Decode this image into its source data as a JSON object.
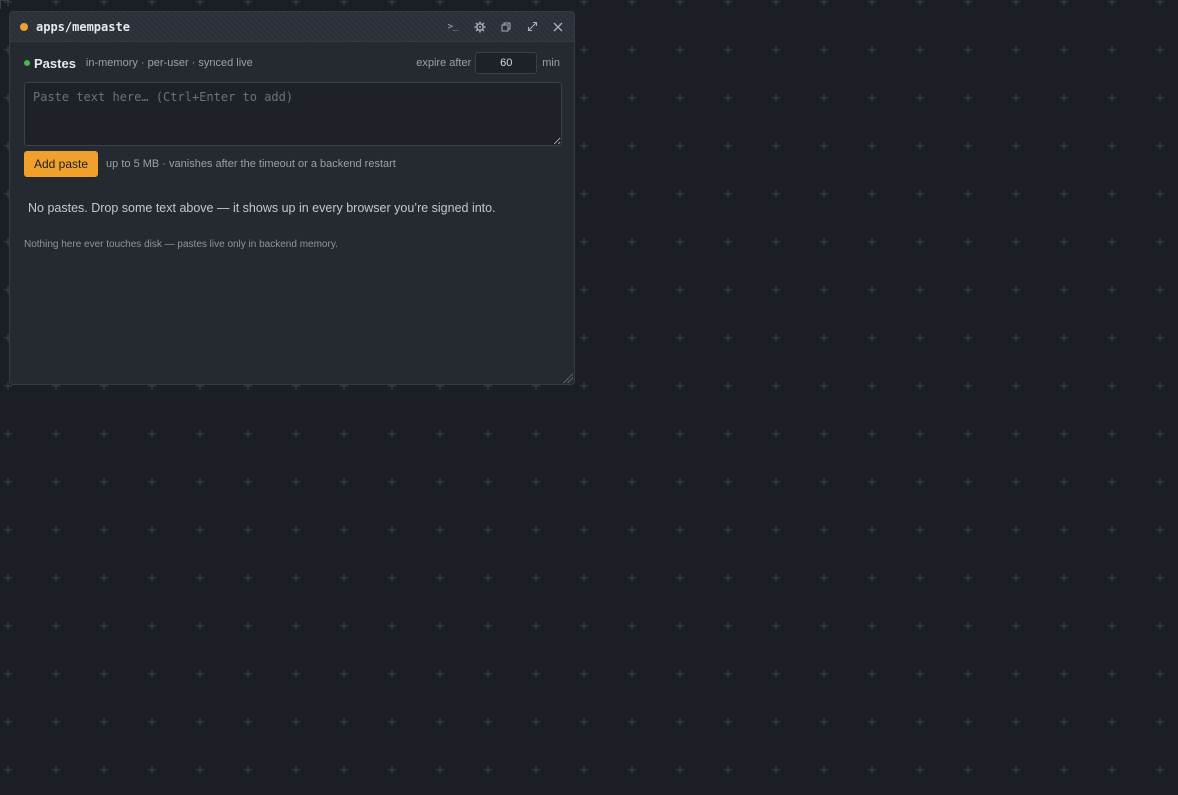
{
  "window": {
    "title": "apps/mempaste",
    "icons": {
      "terminal": ">_",
      "settings": "gear-icon",
      "copy": "copy-icon",
      "expand": "expand-icon",
      "close": "close-icon"
    }
  },
  "header": {
    "title": "Pastes",
    "subtitle": "in-memory · per-user · synced live",
    "expire_label": "expire after",
    "expire_value": "60",
    "expire_unit": "min"
  },
  "composer": {
    "placeholder": "Paste text here… (Ctrl+Enter to add)",
    "add_label": "Add paste",
    "limit_note": "up to 5 MB · vanishes after the timeout or a backend restart"
  },
  "list": {
    "empty_text": "No pastes. Drop some text above — it shows up in every browser you’re signed into."
  },
  "footer": {
    "note": "Nothing here ever touches disk — pastes live only in backend memory."
  },
  "colors": {
    "accent": "#f0a12c",
    "status": "#3fb950",
    "background": "#1b1e25",
    "panel": "#252930"
  }
}
